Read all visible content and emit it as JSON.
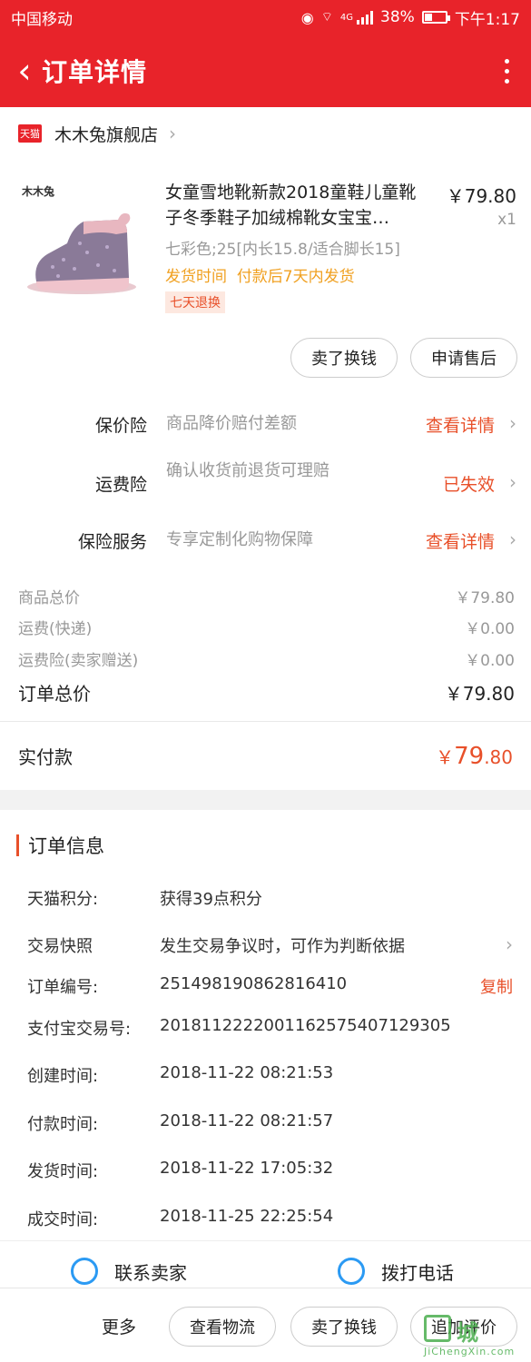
{
  "status": {
    "carrier": "中国移动",
    "network": "4G",
    "battery": "38%",
    "battery_level": 0.38,
    "time": "下午1:17"
  },
  "header": {
    "title": "订单详情"
  },
  "store": {
    "badge": "天猫",
    "name": "木木兔旗舰店"
  },
  "product": {
    "brand": "木木兔",
    "title": "女童雪地靴新款2018童鞋儿童靴子冬季鞋子加绒棉靴女宝宝…",
    "price": "￥79.80",
    "qty": "x1",
    "sku": "七彩色;25[内长15.8/适合脚长15]",
    "ship_label": "发货时间",
    "ship_value": "付款后7天内发货",
    "refund_tag": "七天退换"
  },
  "actions": {
    "exchange": "卖了换钱",
    "aftersale": "申请售后"
  },
  "insurance": [
    {
      "label": "保价险",
      "desc": "商品降价赔付差额",
      "action": "查看详情"
    },
    {
      "label": "运费险",
      "desc": "确认收货前退货可理赔",
      "action": "已失效"
    },
    {
      "label": "保险服务",
      "desc": "专享定制化购物保障",
      "action": "查看详情"
    }
  ],
  "costs": [
    {
      "label": "商品总价",
      "value": "￥79.80"
    },
    {
      "label": "运费(快递)",
      "value": "￥0.00"
    },
    {
      "label": "运费险(卖家赠送)",
      "value": "￥0.00"
    },
    {
      "label": "订单总价",
      "value": "￥79.80"
    }
  ],
  "paid": {
    "label": "实付款",
    "symbol": "￥",
    "int": "79",
    "dec": ".80"
  },
  "order_info": {
    "title": "订单信息",
    "rows": [
      {
        "key": "天猫积分:",
        "value": "获得39点积分"
      },
      {
        "key": "交易快照",
        "value": "发生交易争议时，可作为判断依据"
      },
      {
        "key": "订单编号:",
        "value": "251498190862816410"
      },
      {
        "key": "支付宝交易号:",
        "value": "2018112222001162575407129305"
      },
      {
        "key": "创建时间:",
        "value": "2018-11-22 08:21:53"
      },
      {
        "key": "付款时间:",
        "value": "2018-11-22 08:21:57"
      },
      {
        "key": "发货时间:",
        "value": "2018-11-22 17:05:32"
      },
      {
        "key": "成交时间:",
        "value": "2018-11-25 22:25:54"
      }
    ],
    "copy": "复制"
  },
  "contact": {
    "seller": "联系卖家",
    "call": "拨打电话"
  },
  "bottom": {
    "more": "更多",
    "logistics": "查看物流",
    "exchange": "卖了换钱",
    "review": "追加评价"
  },
  "watermark": {
    "text": "城",
    "url": "JiChengXin.com"
  },
  "colors": {
    "header": "#e8232a",
    "accent": "#e8502a",
    "warning": "#f0a020",
    "link_blue": "#2b9af3"
  }
}
